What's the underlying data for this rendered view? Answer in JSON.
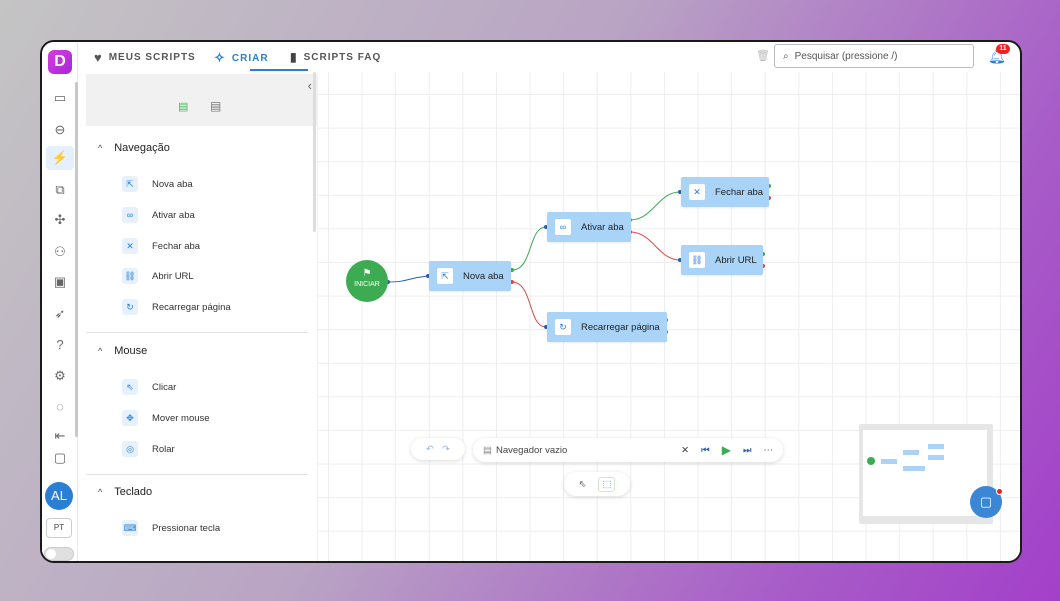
{
  "app": {
    "logo_letter": "D"
  },
  "topbar": {
    "tabs": [
      {
        "label": "MEUS SCRIPTS",
        "icon": "heart-icon"
      },
      {
        "label": "CRIAR",
        "icon": "sparkle-icon",
        "active": true
      },
      {
        "label": "SCRIPTS FAQ",
        "icon": "book-icon"
      }
    ],
    "search_placeholder": "Pesquisar (pressione /)",
    "notifications_count": "11"
  },
  "rail": {
    "avatar_initials": "AL",
    "language": "PT"
  },
  "panel": {
    "sections": [
      {
        "title": "Navegação",
        "items": [
          {
            "label": "Nova aba",
            "icon": "external-link-icon"
          },
          {
            "label": "Ativar aba",
            "icon": "link-icon"
          },
          {
            "label": "Fechar aba",
            "icon": "close-icon"
          },
          {
            "label": "Abrir URL",
            "icon": "chain-link-icon"
          },
          {
            "label": "Recarregar página",
            "icon": "refresh-icon"
          }
        ]
      },
      {
        "title": "Mouse",
        "items": [
          {
            "label": "Clicar",
            "icon": "cursor-click-icon"
          },
          {
            "label": "Mover mouse",
            "icon": "move-icon"
          },
          {
            "label": "Rolar",
            "icon": "scroll-wheel-icon"
          }
        ]
      },
      {
        "title": "Teclado",
        "items": [
          {
            "label": "Pressionar tecla",
            "icon": "keyboard-icon"
          }
        ]
      }
    ]
  },
  "canvas": {
    "start_label": "INICIAR",
    "nodes": [
      {
        "id": "nova",
        "label": "Nova aba",
        "icon": "external-link-icon"
      },
      {
        "id": "ativar",
        "label": "Ativar aba",
        "icon": "link-icon"
      },
      {
        "id": "recarregar",
        "label": "Recarregar página",
        "icon": "refresh-icon"
      },
      {
        "id": "fechar",
        "label": "Fechar aba",
        "icon": "close-icon"
      },
      {
        "id": "abrir",
        "label": "Abrir URL",
        "icon": "chain-link-icon"
      }
    ],
    "browser_status": "Navegador vazio"
  },
  "colors": {
    "accent": "#2a7fd4",
    "node_fill": "#a9d3f7",
    "start_fill": "#3cab52",
    "success_edge": "#3cab52",
    "fail_edge": "#e04848",
    "badge": "#e22222"
  }
}
